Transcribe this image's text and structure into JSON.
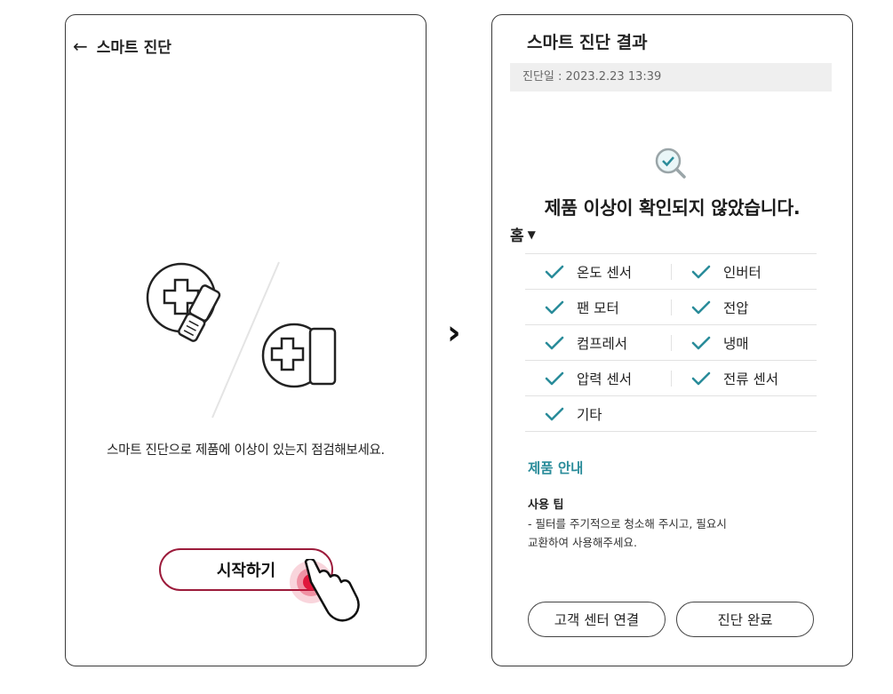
{
  "left_screen": {
    "title": "스마트 진단",
    "intro_text": "스마트 진단으로 제품에 이상이 있는지 점검해보세요.",
    "start_button": "시작하기",
    "back_icon": "back-arrow-icon"
  },
  "right_screen": {
    "title": "스마트 진단 결과",
    "date_label": "진단일 : 2023.2.23 13:39",
    "result_message": "제품 이상이 확인되지 않았습니다.",
    "category": "홈",
    "check_items": [
      {
        "label": "온도 센서",
        "status": "ok"
      },
      {
        "label": "인버터",
        "status": "ok"
      },
      {
        "label": "팬 모터",
        "status": "ok"
      },
      {
        "label": "전압",
        "status": "ok"
      },
      {
        "label": "컴프레서",
        "status": "ok"
      },
      {
        "label": "냉매",
        "status": "ok"
      },
      {
        "label": "압력 센서",
        "status": "ok"
      },
      {
        "label": "전류 센서",
        "status": "ok"
      },
      {
        "label": "기타",
        "status": "ok"
      }
    ],
    "guide_title": "제품 안내",
    "tip_title": "사용 팁",
    "tip_body": "- 필터를 주기적으로 청소해 주시고, 필요시\n교환하여 사용해주세요.",
    "support_button": "고객 센터 연결",
    "done_button": "진단 완료"
  },
  "colors": {
    "accent_teal": "#2a8c9a",
    "start_border": "#9c1b3b",
    "tap_red": "#e0183c"
  }
}
